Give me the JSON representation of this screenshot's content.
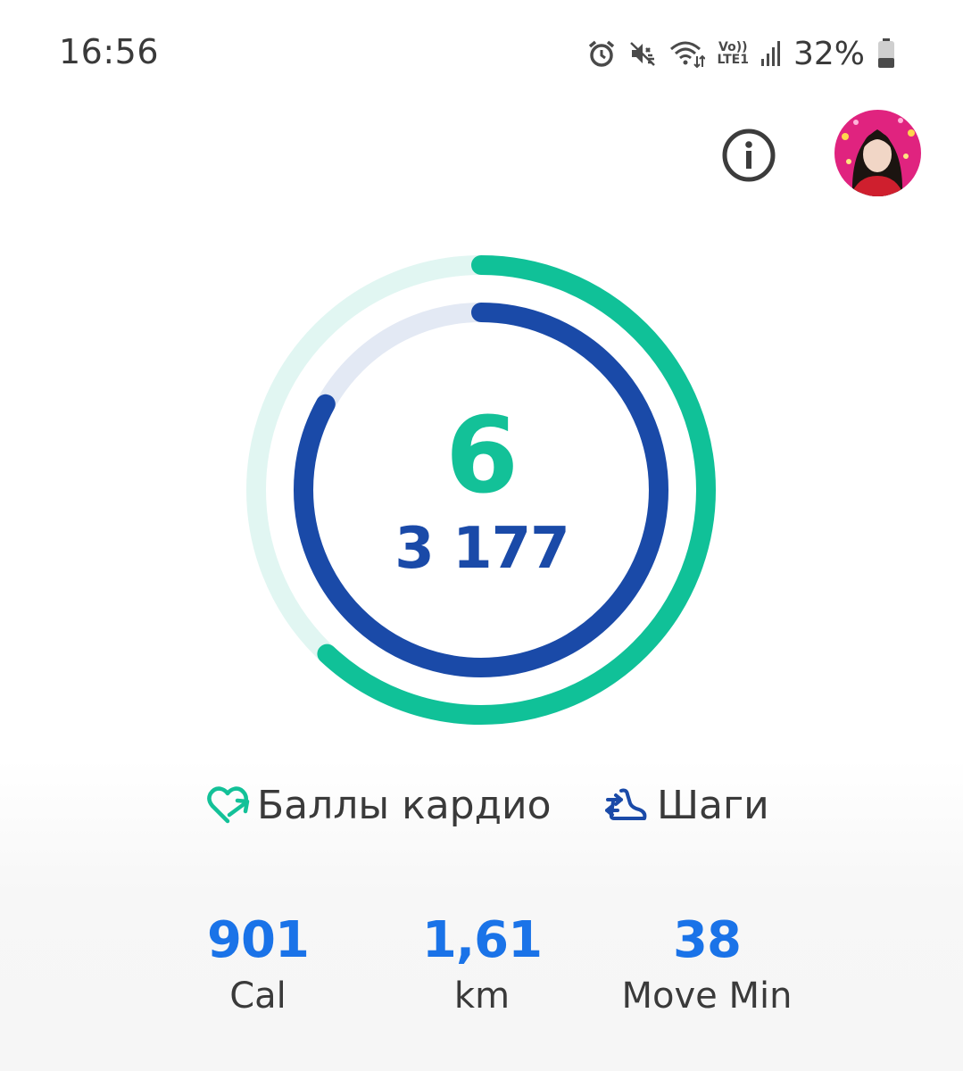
{
  "status_bar": {
    "time": "16:56",
    "network_top": "Vo))",
    "network_bottom": "LTE1",
    "battery": "32%",
    "icons": [
      "alarm-icon",
      "mute-vibrate-icon",
      "wifi-icon",
      "volte-icon",
      "signal-icon",
      "battery-icon"
    ]
  },
  "header": {
    "info_icon": "info-icon",
    "avatar": "profile-avatar"
  },
  "rings": {
    "heart_points": "6",
    "steps": "3 177",
    "outer_progress": 0.62,
    "inner_progress": 0.83,
    "outer_color": "#10c198",
    "outer_track": "#e1f6f2",
    "inner_color": "#1a4aa8",
    "inner_track": "#e3e9f4"
  },
  "legend": {
    "cardio_label": "Баллы кардио",
    "cardio_icon": "heart-points-icon",
    "steps_label": "Шаги",
    "steps_icon": "steps-icon"
  },
  "stats": [
    {
      "value": "901",
      "label": "Cal"
    },
    {
      "value": "1,61",
      "label": "km"
    },
    {
      "value": "38",
      "label": "Move Min"
    }
  ]
}
